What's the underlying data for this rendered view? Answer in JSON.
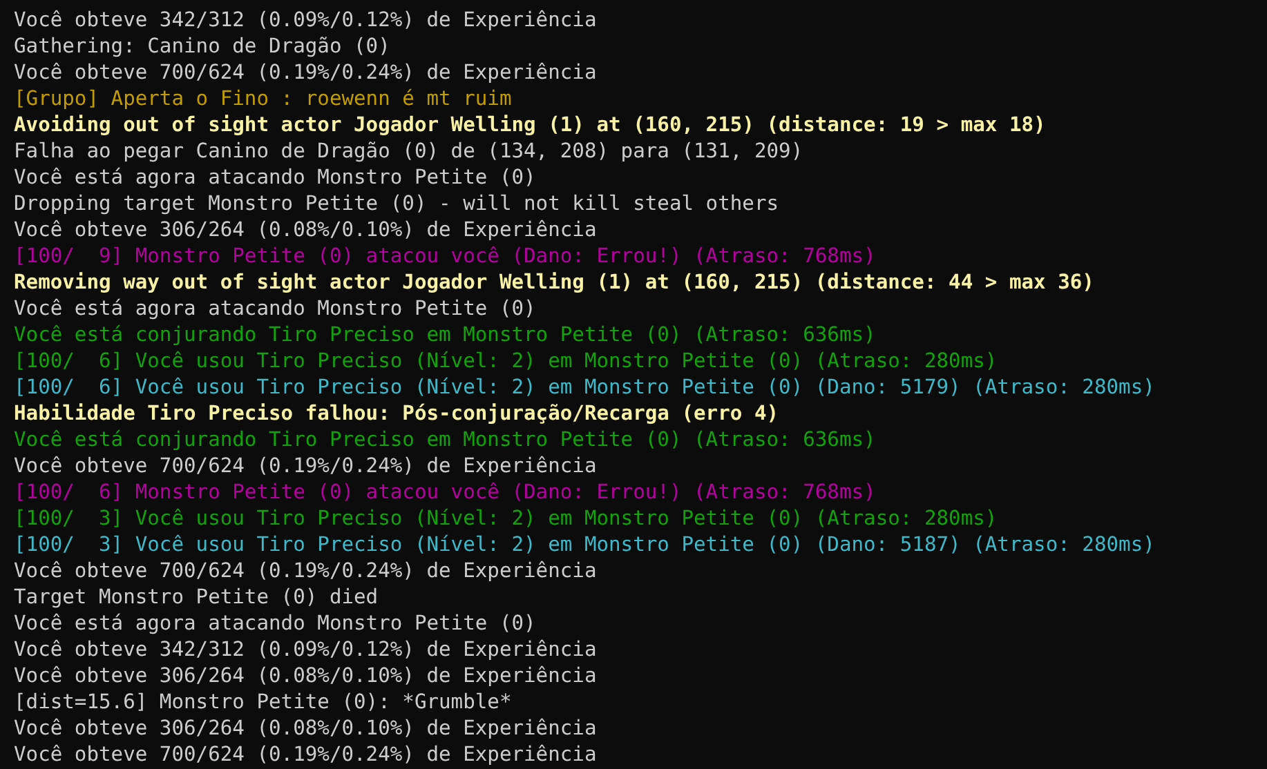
{
  "terminal": {
    "lines": [
      {
        "text": "Você obteve 342/312 (0.09%/0.12%) de Experiência",
        "color": "#cccccc",
        "bold": false
      },
      {
        "text": "Gathering: Canino de Dragão (0)",
        "color": "#cccccc",
        "bold": false
      },
      {
        "text": "Você obteve 700/624 (0.19%/0.24%) de Experiência",
        "color": "#cccccc",
        "bold": false
      },
      {
        "text": "[Grupo] Aperta o Fino : roewenn é mt ruim",
        "color": "#c19c00",
        "bold": false
      },
      {
        "text": "Avoiding out of sight actor Jogador Welling (1) at (160, 215) (distance: 19 > max 18)",
        "color": "#f9f1a5",
        "bold": true
      },
      {
        "text": "Falha ao pegar Canino de Dragão (0) de (134, 208) para (131, 209)",
        "color": "#cccccc",
        "bold": false
      },
      {
        "text": "Você está agora atacando Monstro Petite (0)",
        "color": "#cccccc",
        "bold": false
      },
      {
        "text": "Dropping target Monstro Petite (0) - will not kill steal others",
        "color": "#cccccc",
        "bold": false
      },
      {
        "text": "Você obteve 306/264 (0.08%/0.10%) de Experiência",
        "color": "#cccccc",
        "bold": false
      },
      {
        "text": "[100/  9] Monstro Petite (0) atacou você (Dano: Errou!) (Atraso: 768ms)",
        "color": "#b4009e",
        "bold": false
      },
      {
        "text": "Removing way out of sight actor Jogador Welling (1) at (160, 215) (distance: 44 > max 36)",
        "color": "#f9f1a5",
        "bold": true
      },
      {
        "text": "Você está agora atacando Monstro Petite (0)",
        "color": "#cccccc",
        "bold": false
      },
      {
        "text": "Você está conjurando Tiro Preciso em Monstro Petite (0) (Atraso: 636ms)",
        "color": "#13a10e",
        "bold": false
      },
      {
        "text": "[100/  6] Você usou Tiro Preciso (Nível: 2) em Monstro Petite (0) (Atraso: 280ms)",
        "color": "#13a10e",
        "bold": false
      },
      {
        "text": "[100/  6] Você usou Tiro Preciso (Nível: 2) em Monstro Petite (0) (Dano: 5179) (Atraso: 280ms)",
        "color": "#3fb8c8",
        "bold": false
      },
      {
        "text": "Habilidade Tiro Preciso falhou: Pós-conjuração/Recarga (erro 4)",
        "color": "#f9f1a5",
        "bold": true
      },
      {
        "text": "Você está conjurando Tiro Preciso em Monstro Petite (0) (Atraso: 636ms)",
        "color": "#13a10e",
        "bold": false
      },
      {
        "text": "Você obteve 700/624 (0.19%/0.24%) de Experiência",
        "color": "#cccccc",
        "bold": false
      },
      {
        "text": "[100/  6] Monstro Petite (0) atacou você (Dano: Errou!) (Atraso: 768ms)",
        "color": "#b4009e",
        "bold": false
      },
      {
        "text": "[100/  3] Você usou Tiro Preciso (Nível: 2) em Monstro Petite (0) (Atraso: 280ms)",
        "color": "#13a10e",
        "bold": false
      },
      {
        "text": "[100/  3] Você usou Tiro Preciso (Nível: 2) em Monstro Petite (0) (Dano: 5187) (Atraso: 280ms)",
        "color": "#3fb8c8",
        "bold": false
      },
      {
        "text": "Você obteve 700/624 (0.19%/0.24%) de Experiência",
        "color": "#cccccc",
        "bold": false
      },
      {
        "text": "Target Monstro Petite (0) died",
        "color": "#cccccc",
        "bold": false
      },
      {
        "text": "Você está agora atacando Monstro Petite (0)",
        "color": "#cccccc",
        "bold": false
      },
      {
        "text": "Você obteve 342/312 (0.09%/0.12%) de Experiência",
        "color": "#cccccc",
        "bold": false
      },
      {
        "text": "Você obteve 306/264 (0.08%/0.10%) de Experiência",
        "color": "#cccccc",
        "bold": false
      },
      {
        "text": "[dist=15.6] Monstro Petite (0): *Grumble*",
        "color": "#cccccc",
        "bold": false
      },
      {
        "text": "Você obteve 306/264 (0.08%/0.10%) de Experiência",
        "color": "#cccccc",
        "bold": false
      },
      {
        "text": "Você obteve 700/624 (0.19%/0.24%) de Experiência",
        "color": "#cccccc",
        "bold": false
      }
    ]
  }
}
